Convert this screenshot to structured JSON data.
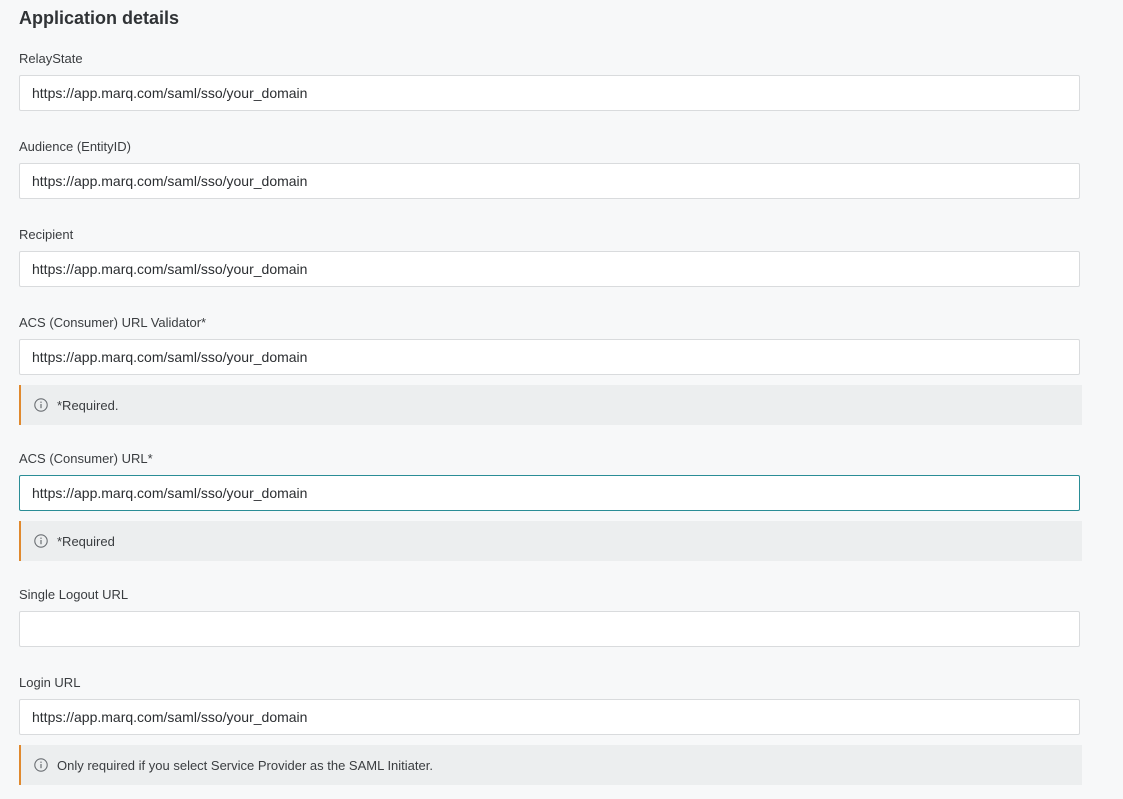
{
  "section": {
    "title": "Application details"
  },
  "fields": {
    "relay_state": {
      "label": "RelayState",
      "value": "https://app.marq.com/saml/sso/your_domain"
    },
    "audience": {
      "label": "Audience (EntityID)",
      "value": "https://app.marq.com/saml/sso/your_domain"
    },
    "recipient": {
      "label": "Recipient",
      "value": "https://app.marq.com/saml/sso/your_domain"
    },
    "acs_validator": {
      "label": "ACS (Consumer) URL Validator*",
      "value": "https://app.marq.com/saml/sso/your_domain",
      "note": "*Required."
    },
    "acs_url": {
      "label": "ACS (Consumer) URL*",
      "value": "https://app.marq.com/saml/sso/your_domain",
      "note": "*Required"
    },
    "single_logout": {
      "label": "Single Logout URL",
      "value": ""
    },
    "login_url": {
      "label": "Login URL",
      "value": "https://app.marq.com/saml/sso/your_domain",
      "note": "Only required if you select Service Provider as the SAML Initiater."
    }
  },
  "colors": {
    "note_accent": "#e0892e",
    "focus_border": "#2a8d96",
    "background": "#f7f8f9"
  },
  "icons": {
    "note_icon": "info-icon"
  }
}
